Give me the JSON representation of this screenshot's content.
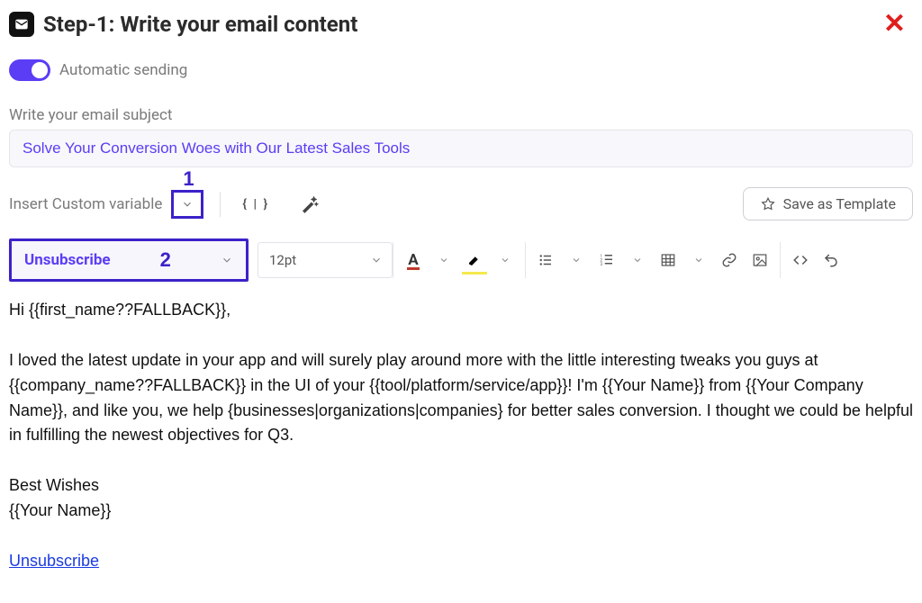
{
  "header": {
    "title": "Step-1:  Write your email content"
  },
  "toggle": {
    "label": "Automatic sending",
    "on": true
  },
  "subject": {
    "label": "Write your email subject",
    "value": "Solve Your Conversion Woes with Our Latest Sales Tools"
  },
  "insert_var": {
    "label": "Insert Custom variable"
  },
  "save_template": {
    "label": "Save as Template"
  },
  "callouts": {
    "one": "1",
    "two": "2"
  },
  "dropdowns": {
    "unsubscribe": "Unsubscribe",
    "font_size": "12pt"
  },
  "body": {
    "greeting": "Hi {{first_name??FALLBACK}},",
    "p1": "I loved the latest update in your app and will surely play around more with the little interesting tweaks you guys at {{company_name??FALLBACK}} in the UI of your {{tool/platform/service/app}}! I'm {{Your Name}} from {{Your Company Name}}, and like you, we help {businesses|organizations|companies} for better sales conversion. I thought we could be helpful in fulfilling the newest objectives for Q3.",
    "signoff": "Best Wishes",
    "signature": "{{Your Name}}",
    "unsubscribe_link": "Unsubscribe"
  }
}
